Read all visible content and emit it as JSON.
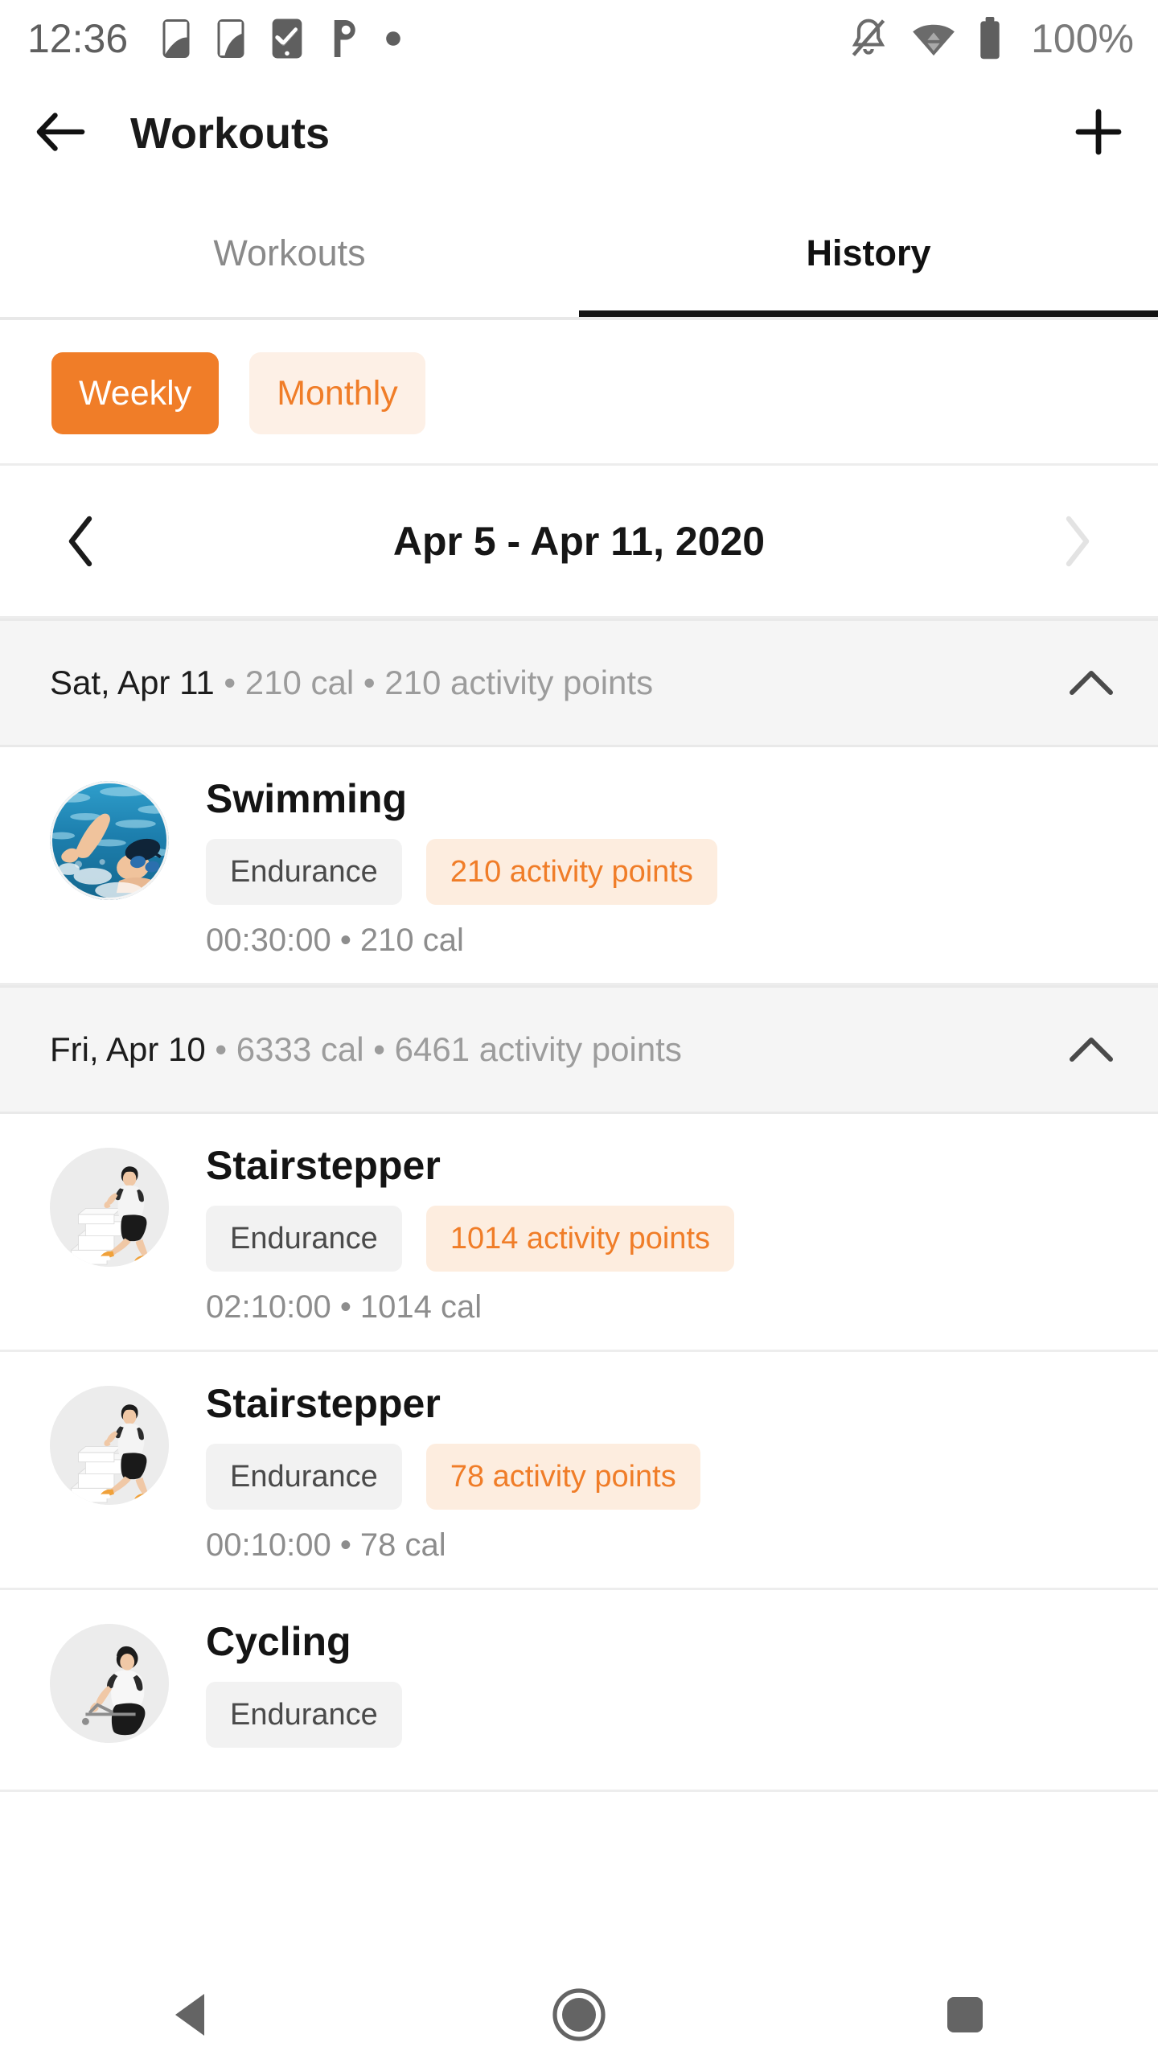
{
  "status_bar": {
    "time": "12:36",
    "battery_text": "100%",
    "left_icons": [
      "sim-card-1-icon",
      "sim-card-2-icon",
      "task-check-icon",
      "parking-p-icon",
      "dot-icon"
    ],
    "right_icons": [
      "notifications-off-icon",
      "wifi-icon",
      "battery-full-icon"
    ]
  },
  "app_bar": {
    "back_icon": "back-arrow-icon",
    "title": "Workouts",
    "add_icon": "plus-icon"
  },
  "tabs": {
    "items": [
      {
        "label": "Workouts",
        "active": false
      },
      {
        "label": "History",
        "active": true
      }
    ]
  },
  "filters": {
    "chips": [
      {
        "label": "Weekly",
        "selected": true
      },
      {
        "label": "Monthly",
        "selected": false
      }
    ]
  },
  "date_nav": {
    "prev_icon": "chevron-left-icon",
    "next_icon": "chevron-right-icon",
    "range_label": "Apr 5 - Apr 11, 2020"
  },
  "groups": [
    {
      "date": "Sat, Apr 11",
      "separator_1": " • ",
      "calories": "210 cal",
      "separator_2": " • ",
      "points": "210 activity points",
      "collapse_icon": "chevron-up-icon",
      "workouts": [
        {
          "title": "Swimming",
          "thumb": "swimming-photo",
          "category": "Endurance",
          "points": "210 activity points",
          "meta": "00:30:00 • 210 cal"
        }
      ]
    },
    {
      "date": "Fri, Apr 10",
      "separator_1": " • ",
      "calories": "6333 cal",
      "separator_2": " • ",
      "points": "6461 activity points",
      "collapse_icon": "chevron-up-icon",
      "workouts": [
        {
          "title": "Stairstepper",
          "thumb": "stairstepper-illustration",
          "category": "Endurance",
          "points": "1014 activity points",
          "meta": "02:10:00 • 1014 cal"
        },
        {
          "title": "Stairstepper",
          "thumb": "stairstepper-illustration",
          "category": "Endurance",
          "points": "78 activity points",
          "meta": "00:10:00 • 78 cal"
        },
        {
          "title": "Cycling",
          "thumb": "cycling-illustration",
          "category": "Endurance",
          "points": "",
          "meta": ""
        }
      ]
    }
  ],
  "nav_bar": {
    "back_icon": "nav-back-triangle-icon",
    "home_icon": "nav-home-circle-icon",
    "recents_icon": "nav-recents-square-icon"
  },
  "colors": {
    "accent": "#F07D28",
    "accent_soft": "#FDEDDF",
    "chip_soft": "#FDF0E6",
    "group_bg": "#F5F5F5",
    "muted_text": "#9C9C9C",
    "divider": "#EDEDED"
  }
}
